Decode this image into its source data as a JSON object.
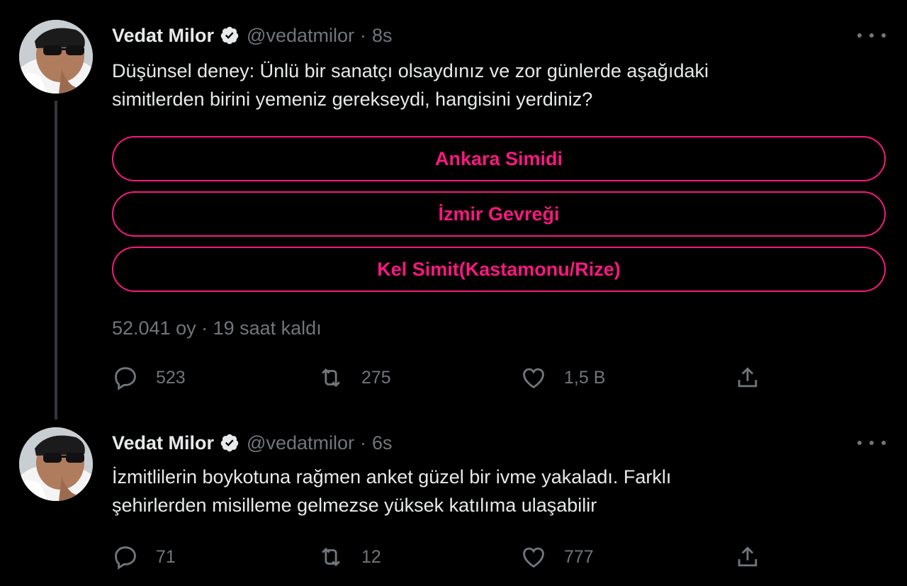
{
  "colors": {
    "accent": "#f91880",
    "muted": "#71767b",
    "text": "#e7e9ea",
    "verified_bg": "#e7e9ea"
  },
  "tweets": [
    {
      "name": "Vedat Milor",
      "handle": "@vedatmilor",
      "dot": "·",
      "time": "8s",
      "text_lines": [
        "Düşünsel deney: Ünlü bir sanatçı olsaydınız ve zor günlerde aşağıdaki",
        "simitlerden birini yemeniz gerekseydi, hangisini yerdiniz?"
      ],
      "poll": {
        "options": [
          "Ankara Simidi",
          "İzmir Gevreği",
          "Kel Simit(Kastamonu/Rize)"
        ],
        "meta": "52.041 oy · 19 saat kaldı"
      },
      "actions": {
        "reply": "523",
        "retweet": "275",
        "like": "1,5 B"
      },
      "icons": [
        "reply-icon",
        "retweet-icon",
        "like-icon",
        "share-icon",
        "more-icon",
        "verified-icon"
      ]
    },
    {
      "name": "Vedat Milor",
      "handle": "@vedatmilor",
      "dot": "·",
      "time": "6s",
      "text_lines": [
        "İzmitlilerin boykotuna rağmen anket güzel bir ivme yakaladı. Farklı",
        "şehirlerden misilleme gelmezse yüksek katılıma ulaşabilir"
      ],
      "actions": {
        "reply": "71",
        "retweet": "12",
        "like": "777"
      },
      "icons": [
        "reply-icon",
        "retweet-icon",
        "like-icon",
        "share-icon",
        "more-icon",
        "verified-icon"
      ]
    }
  ]
}
